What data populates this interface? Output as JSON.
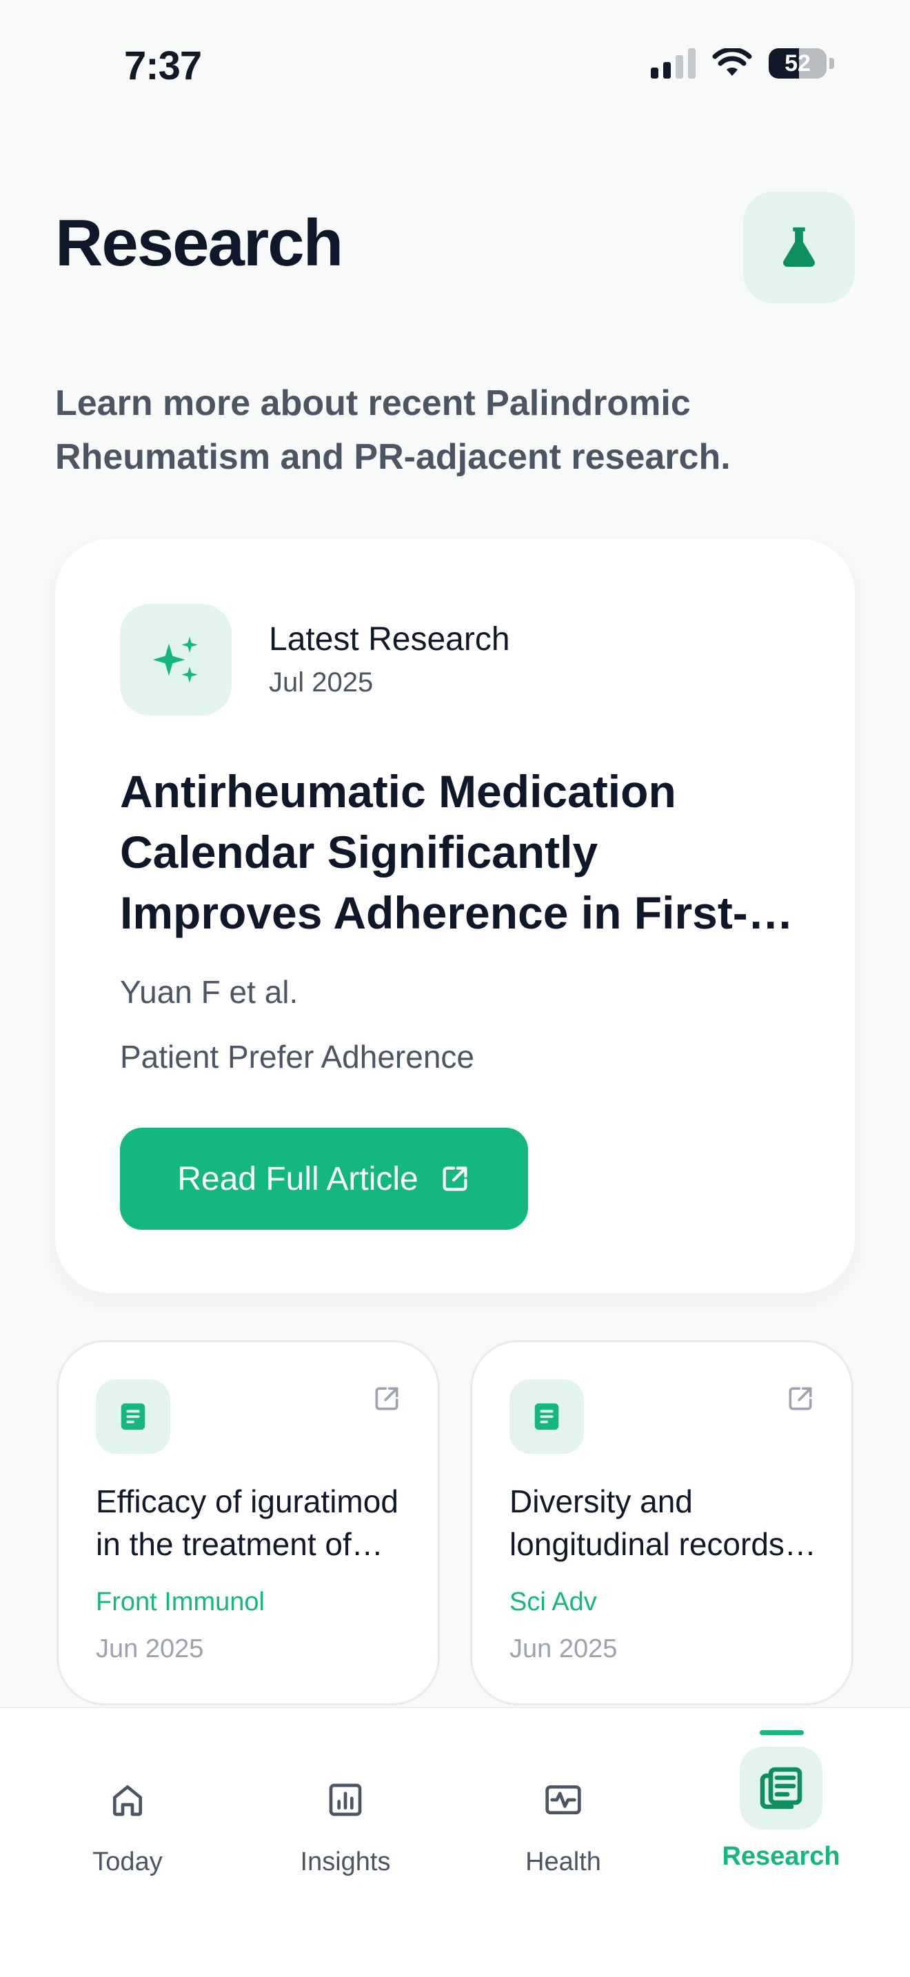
{
  "status_bar": {
    "time": "7:37",
    "battery_level": "52",
    "battery_fraction": 0.52,
    "signal_bars_active": 2,
    "signal_bars_total": 4
  },
  "header": {
    "title": "Research",
    "icon": "flask-icon"
  },
  "subtitle": "Learn more about recent Palindromic Rheumatism and PR-adjacent research.",
  "featured": {
    "icon": "sparkles-icon",
    "label": "Latest Research",
    "date": "Jul 2025",
    "title": "Antirheumatic Medication Calendar Significantly Improves Adherence in First-Year Patients",
    "authors": "Yuan F et al.",
    "journal": "Patient Prefer Adherence",
    "button_label": "Read Full Article",
    "button_icon": "external-link-icon"
  },
  "articles": [
    {
      "icon": "document-icon",
      "title": "Efficacy of iguratimod in the treatment of palindromic rheumatism",
      "journal": "Front Immunol",
      "date": "Jun 2025"
    },
    {
      "icon": "document-icon",
      "title": "Diversity and longitudinal records of immune cells",
      "journal": "Sci Adv",
      "date": "Jun 2025"
    }
  ],
  "nav": {
    "items": [
      {
        "label": "Today",
        "icon": "home-icon",
        "active": false
      },
      {
        "label": "Insights",
        "icon": "bar-chart-icon",
        "active": false
      },
      {
        "label": "Health",
        "icon": "activity-icon",
        "active": false
      },
      {
        "label": "Research",
        "icon": "newspaper-icon",
        "active": true
      }
    ]
  },
  "colors": {
    "accent": "#14b77f",
    "accent_soft": "#e3f4ee",
    "title": "#0f172a",
    "muted": "#4b5563",
    "background": "#f8fafa"
  }
}
